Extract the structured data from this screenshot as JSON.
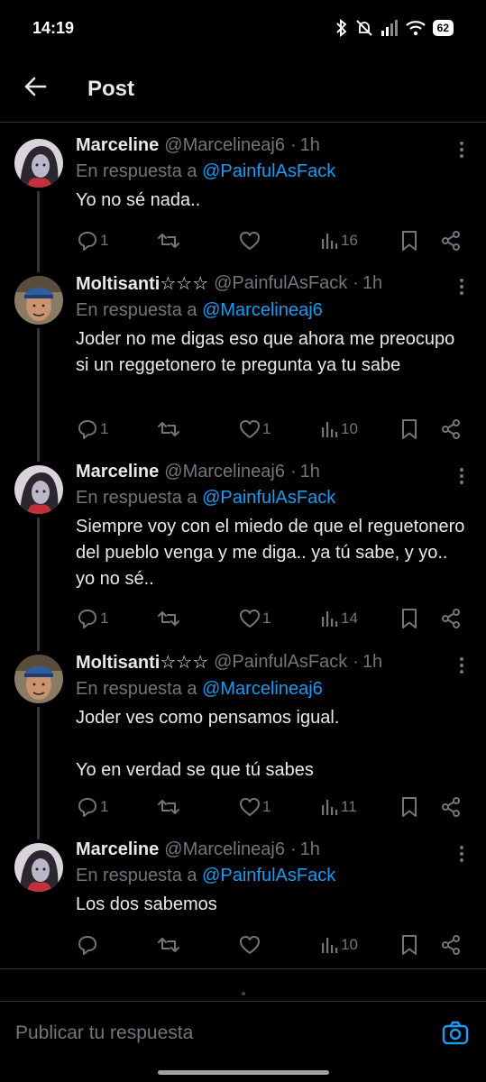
{
  "status_bar": {
    "time": "14:19",
    "battery": "62"
  },
  "header": {
    "title": "Post"
  },
  "reply_prefix": "En respuesta a",
  "tweets": [
    {
      "name": "Marceline",
      "handle": "@Marcelineaj6",
      "time": "1h",
      "reply_to": "@PainfulAsFack",
      "text": "Yo no sé nada..",
      "replies": "1",
      "retweets": "",
      "likes": "",
      "views": "16"
    },
    {
      "name": "Moltisanti☆☆☆",
      "handle": "@PainfulAsFack",
      "time": "1h",
      "reply_to": "@Marcelineaj6",
      "text": "Joder no me digas eso que ahora me preocupo si un reggetonero te pregunta ya tu sabe",
      "replies": "1",
      "retweets": "",
      "likes": "1",
      "views": "10"
    },
    {
      "name": "Marceline",
      "handle": "@Marcelineaj6",
      "time": "1h",
      "reply_to": "@PainfulAsFack",
      "text": "Siempre voy con el miedo de que el reguetonero del pueblo venga y me diga.. ya tú sabe, y yo.. yo no sé..",
      "replies": "1",
      "retweets": "",
      "likes": "1",
      "views": "14"
    },
    {
      "name": "Moltisanti☆☆☆",
      "handle": "@PainfulAsFack",
      "time": "1h",
      "reply_to": "@Marcelineaj6",
      "text": "Joder ves como pensamos igual.\n\nYo en verdad se que tú sabes",
      "replies": "1",
      "retweets": "",
      "likes": "1",
      "views": "11"
    },
    {
      "name": "Marceline",
      "handle": "@Marcelineaj6",
      "time": "1h",
      "reply_to": "@PainfulAsFack",
      "text": "Los dos sabemos",
      "replies": "",
      "retweets": "",
      "likes": "",
      "views": "10"
    }
  ],
  "compose": {
    "placeholder": "Publicar tu respuesta"
  },
  "colors": {
    "accent": "#1d9bf0",
    "muted": "#71767b",
    "text": "#e7e9ea",
    "background": "#000000"
  }
}
